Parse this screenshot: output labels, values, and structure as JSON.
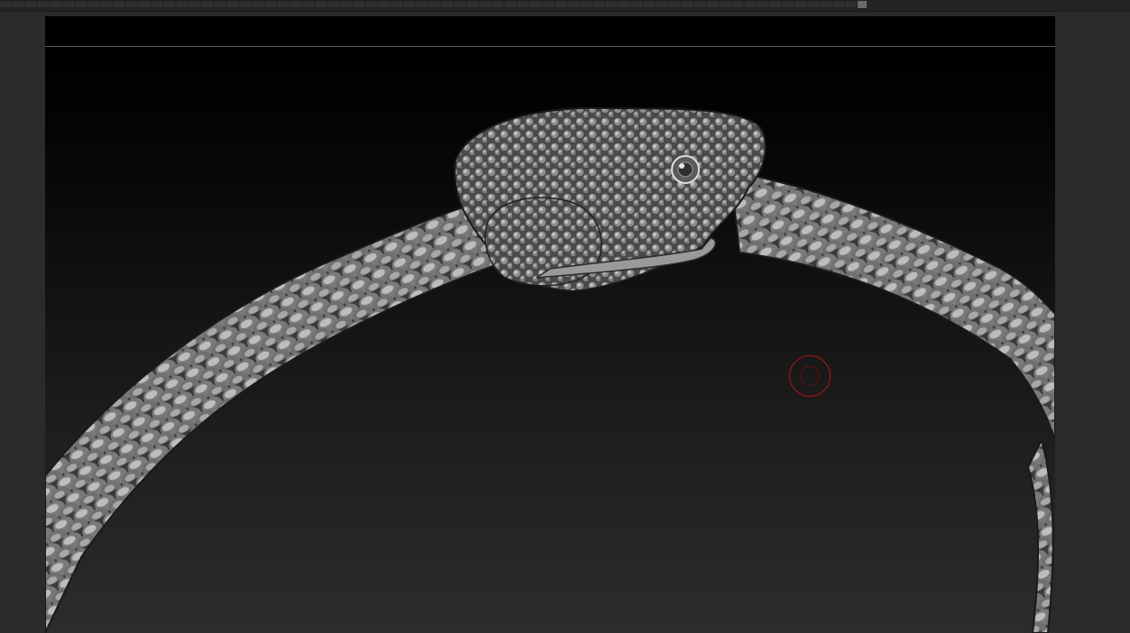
{
  "app": {
    "window_title": ""
  },
  "canvas": {
    "subject": "snake-model",
    "brush": {
      "type": "draw-size-cursor"
    }
  },
  "colors": {
    "background": "#2b2b2b",
    "canvas_top": "#000000",
    "canvas_bottom": "#2c2c2c",
    "brush_ring": "#b11515",
    "model_material": "#8a8a8a"
  }
}
